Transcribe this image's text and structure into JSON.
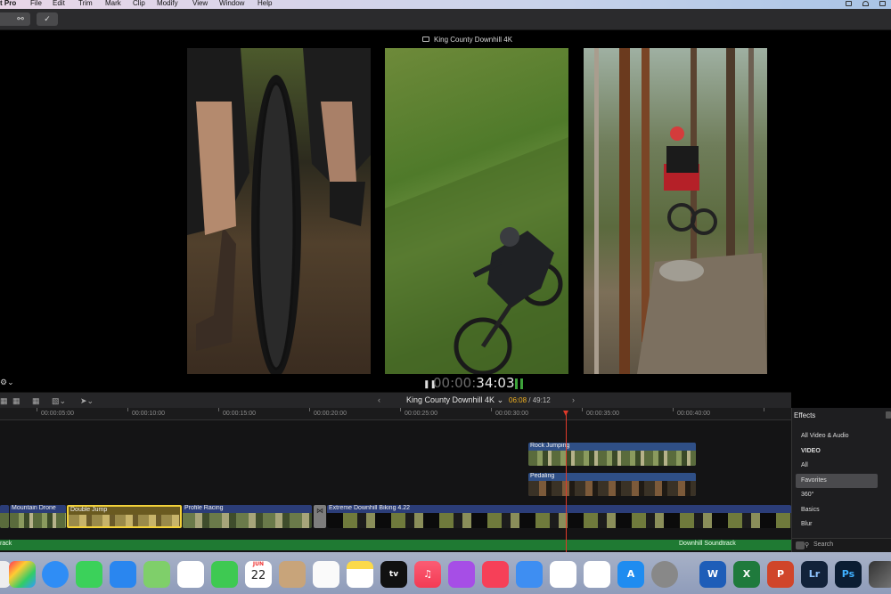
{
  "menubar": {
    "app_name": "t Pro",
    "items": [
      "File",
      "Edit",
      "Trim",
      "Mark",
      "Clip",
      "Modify",
      "View",
      "Window",
      "Help"
    ]
  },
  "toolbar": {
    "key_icon": "key-icon",
    "check_icon": "checkmark-icon"
  },
  "viewer": {
    "title": "King County Downhill 4K",
    "timecode_dim": "00:00:",
    "timecode_lit": "34:03"
  },
  "timeline": {
    "project": "King County Downhill 4K",
    "project_chevron": "⌄",
    "position_current": "06:08",
    "position_total": "/ 49:12",
    "ruler": [
      "00:00:05:00",
      "00:00:10:00",
      "00:00:15:00",
      "00:00:20:00",
      "00:00:25:00",
      "00:00:30:00",
      "00:00:35:00",
      "00:00:40:00"
    ],
    "connected_clips": [
      "Rock Jumping",
      "Pedaling"
    ],
    "primary_clips": [
      "Mountain Drone",
      "Double Jump",
      "Profile Racing",
      "Extreme Downhill Biking 4.22"
    ],
    "audio_labels": [
      "rack",
      "Downhill Soundtrack"
    ]
  },
  "effects": {
    "title": "Effects",
    "items": [
      {
        "label": "All Video & Audio",
        "header": false,
        "selected": false
      },
      {
        "label": "VIDEO",
        "header": true,
        "selected": false
      },
      {
        "label": "All",
        "header": false,
        "selected": false
      },
      {
        "label": "Favorites",
        "header": false,
        "selected": true
      },
      {
        "label": "360°",
        "header": false,
        "selected": false
      },
      {
        "label": "Basics",
        "header": false,
        "selected": false
      },
      {
        "label": "Blur",
        "header": false,
        "selected": false
      }
    ],
    "search_placeholder": "Search"
  },
  "dock": {
    "calendar_month": "JUN",
    "calendar_day": "22",
    "tv_label": "tv",
    "lr_label": "Lr",
    "ps_label": "Ps",
    "word_label": "W",
    "excel_label": "X",
    "ppt_label": "P"
  }
}
